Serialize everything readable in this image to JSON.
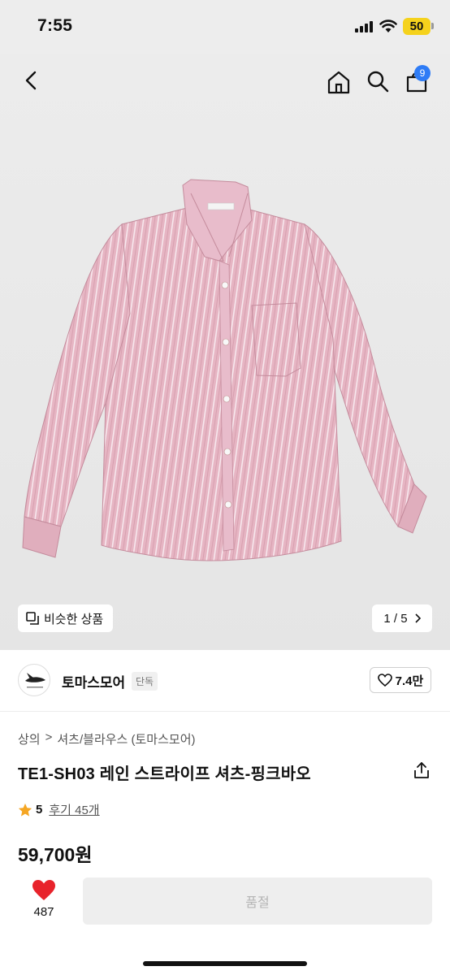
{
  "status_bar": {
    "time": "7:55",
    "battery": "50"
  },
  "nav": {
    "cart_count": "9",
    "icons": [
      "back-icon",
      "home-icon",
      "search-icon",
      "cart-icon"
    ]
  },
  "gallery": {
    "similar_label": "비슷한 상품",
    "pager_current": "1",
    "pager_separator": "/",
    "pager_total": "5"
  },
  "brand": {
    "name": "토마스모어",
    "tag": "단독",
    "likes": "7.4만"
  },
  "breadcrumb": {
    "level1": "상의",
    "separator": ">",
    "level2": "셔츠/블라우스 (토마스모어)"
  },
  "product": {
    "title": "TE1-SH03 레인 스트라이프 셔츠-핑크바오",
    "rating": "5",
    "reviews": "후기 45개",
    "price": "59,700원"
  },
  "bottom_bar": {
    "wish_count": "487",
    "cta_label": "품절"
  },
  "colors": {
    "accent_blue": "#2e7cf6",
    "heart_red": "#e8232b",
    "star": "#f5a623",
    "shirt_pink": "#e5b3c2"
  }
}
